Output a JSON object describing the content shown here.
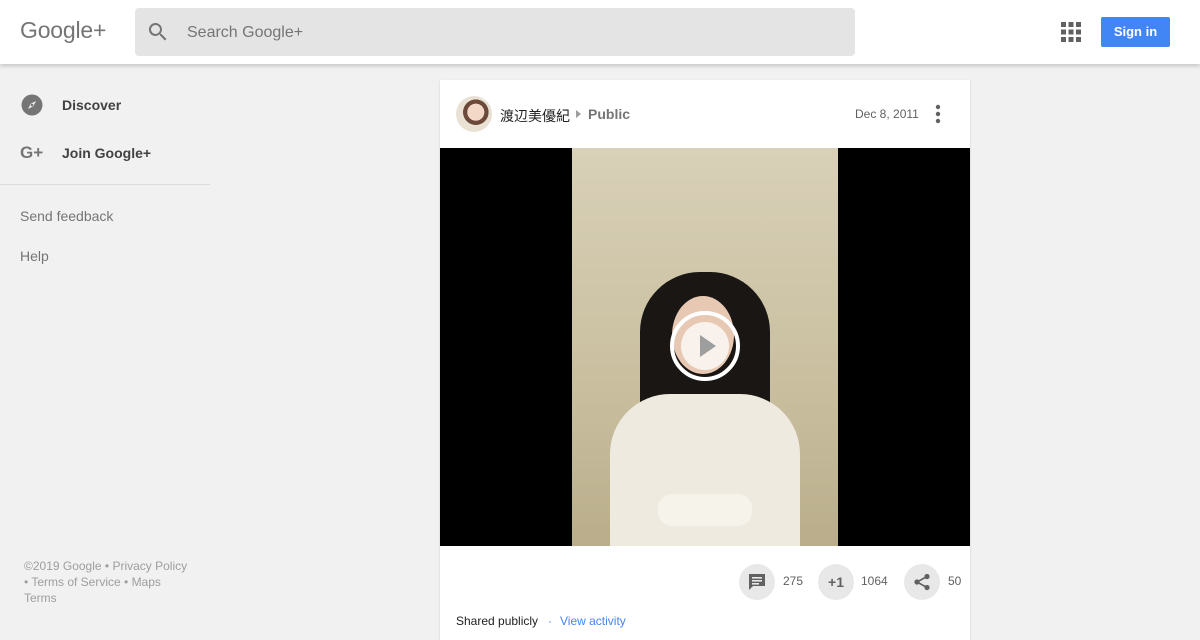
{
  "header": {
    "logo": "Google+",
    "search_placeholder": "Search Google+",
    "apps_icon": "apps-grid-icon",
    "signin_label": "Sign in",
    "signin_color": "#4285f4"
  },
  "sidebar": {
    "items": [
      {
        "label": "Discover",
        "icon": "compass-icon"
      },
      {
        "label": "Join Google+",
        "icon": "google-plus-icon"
      }
    ],
    "links": [
      "Send feedback",
      "Help"
    ],
    "footer": {
      "copyright": "©2019 Google",
      "privacy": "Privacy Policy",
      "terms_of_service": "Terms of Service",
      "maps": "Maps",
      "terms": "Terms"
    }
  },
  "post": {
    "author": "渡辺美優紀",
    "visibility": "Public",
    "date": "Dec 8, 2011",
    "media": "video",
    "comments": "275",
    "plus_ones": "1064",
    "plus_one_label": "+1",
    "shares": "50",
    "shared_text": "Shared publicly",
    "separator": "·",
    "view_activity": "View activity",
    "link_color": "#4285f4"
  }
}
